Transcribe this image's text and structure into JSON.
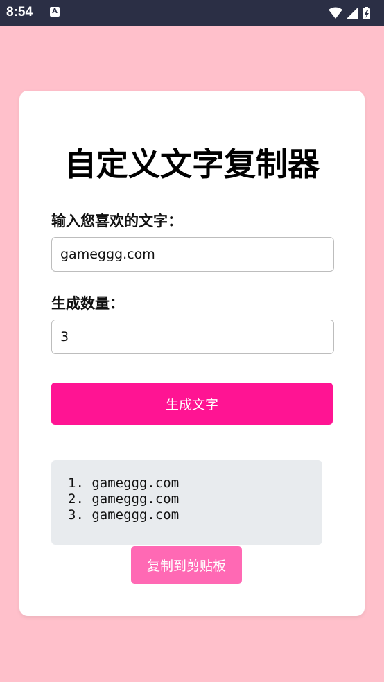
{
  "status_bar": {
    "time": "8:54",
    "app_icon": "A",
    "icons": [
      "wifi-icon",
      "signal-icon",
      "battery-icon"
    ]
  },
  "form": {
    "title": "自定义文字复制器",
    "text_label": "输入您喜欢的文字：",
    "text_value": "gameggg.com",
    "count_label": "生成数量：",
    "count_value": "3",
    "generate_label": "生成文字"
  },
  "results": {
    "items": [
      "1. gameggg.com",
      "2. gameggg.com",
      "3. gameggg.com"
    ]
  },
  "copy_label": "复制到剪贴板",
  "colors": {
    "background": "#ffc0cb",
    "status_bar": "#2b2f45",
    "primary_button": "#ff1493",
    "copy_button": "#ff69b4",
    "result_box": "#e8ebee"
  }
}
